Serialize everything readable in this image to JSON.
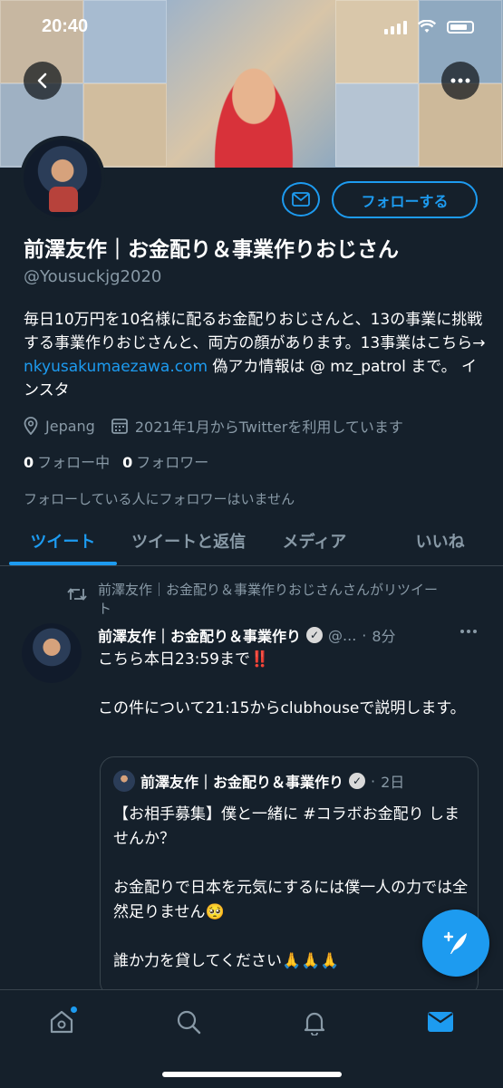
{
  "status_bar": {
    "time": "20:40"
  },
  "profile": {
    "name": "前澤友作｜お金配り＆事業作りおじさん",
    "handle": "@Yousuckjg2020",
    "follow_label": "フォローする",
    "bio": {
      "text1": "毎日10万円を10名様に配るお金配りおじさんと、13の事業に挑戦する事業作りおじさんと、両方の顔があります。13事業はこちら→ ",
      "link": "nkyusakumaezawa.com",
      "text2": " 偽アカ情報は @ mz_patrol まで。 インスタ"
    },
    "location": "Jepang",
    "joined": "2021年1月からTwitterを利用しています",
    "following_count": "0",
    "following_label": "フォロー中",
    "followers_count": "0",
    "followers_label": "フォロワー",
    "no_followers_note": "フォローしている人にフォロワーはいません"
  },
  "tabs": [
    {
      "label": "ツイート"
    },
    {
      "label": "ツイートと返信"
    },
    {
      "label": "メディア"
    },
    {
      "label": "いいね"
    }
  ],
  "tweet": {
    "retweet_note": "前澤友作｜お金配り＆事業作りおじさんさんがリツイート",
    "author": "前澤友作｜お金配り＆事業作り",
    "handle": "@...",
    "separator": "·",
    "time": "8分",
    "line1": "こちら本日23:59まで",
    "exclaim": "‼️",
    "line2": "この件について21:15からclubhouseで説明します。",
    "quote": {
      "author": "前澤友作｜お金配り＆事業作り",
      "separator": "·",
      "time": "2日",
      "para1": "【お相手募集】僕と一緒に #コラボお金配り しませんか？",
      "para2": "お金配りで日本を元気にするには僕一人の力では全然足りません🥺",
      "para3": "誰か力を貸してください🙏🙏🙏"
    }
  },
  "icons": {
    "back": "back-arrow-icon",
    "more": "more-icon",
    "mail": "mail-icon",
    "location": "location-icon",
    "calendar": "calendar-icon",
    "retweet": "retweet-icon",
    "verified": "verified-icon",
    "compose": "compose-icon",
    "home": "home-icon",
    "search": "search-icon",
    "notifications": "bell-icon",
    "messages": "mail-icon"
  },
  "colors": {
    "background": "#15202b",
    "accent": "#1d9bf0",
    "secondary_text": "#8899a6",
    "border": "#38444d"
  }
}
